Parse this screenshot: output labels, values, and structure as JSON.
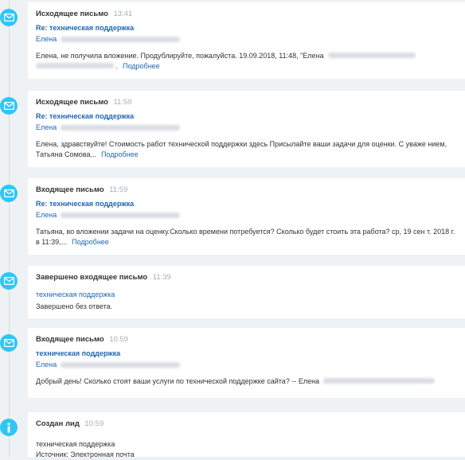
{
  "events": [
    {
      "type": "outgoing",
      "title": "Исходящее письмо",
      "time": "13:41",
      "subject": "Re: техническая поддержка",
      "contact": "Елена",
      "body_start": "Елена, не получила вложение. Продублируйте, пожалуйста.  19.09.2018, 11:48, \"Елена",
      "more": "Подробнее"
    },
    {
      "type": "outgoing",
      "title": "Исходящее письмо",
      "time": "11:59",
      "subject": "Re: техническая поддержка",
      "contact": "Елена",
      "body": "Елена, здравствуйте! Стоимость работ технической поддержки здесь Присылайте ваши задачи для оценки. С уваже нием, Татьяна Сомова...",
      "more": "Подробнее"
    },
    {
      "type": "incoming",
      "title": "Входящее письмо",
      "time": "11:59",
      "subject": "Re: техническая поддержка",
      "contact": "Елена",
      "body": "Татьяна, во вложении задачи на оценку.Сколько времени потребуется? Сколько будет стоить эта работа? ср, 19 сен т. 2018 г. в 11:39,...",
      "more": "Подробнее"
    },
    {
      "type": "completed",
      "title": "Завершено входящее письмо",
      "time": "11:39",
      "subject": "техническая поддержка",
      "status": "Завершено без ответа."
    },
    {
      "type": "incoming",
      "title": "Входящее письмо",
      "time": "10:59",
      "subject": "техническая поддержка",
      "contact": "Елена",
      "body": "Добрый день! Сколько стоят ваши услуги по технической поддержке сайта? -- Елена"
    },
    {
      "type": "lead",
      "title": "Создан лид",
      "time": "10:59",
      "name": "техническая поддержка",
      "source": "Источник: Электронная почта"
    }
  ],
  "icons": {
    "mail": "envelope-icon",
    "info": "info-icon"
  },
  "colors": {
    "marker": "#2fc6f6",
    "link": "#2067b0",
    "time": "#a8adb4",
    "background": "#eef2f4"
  }
}
